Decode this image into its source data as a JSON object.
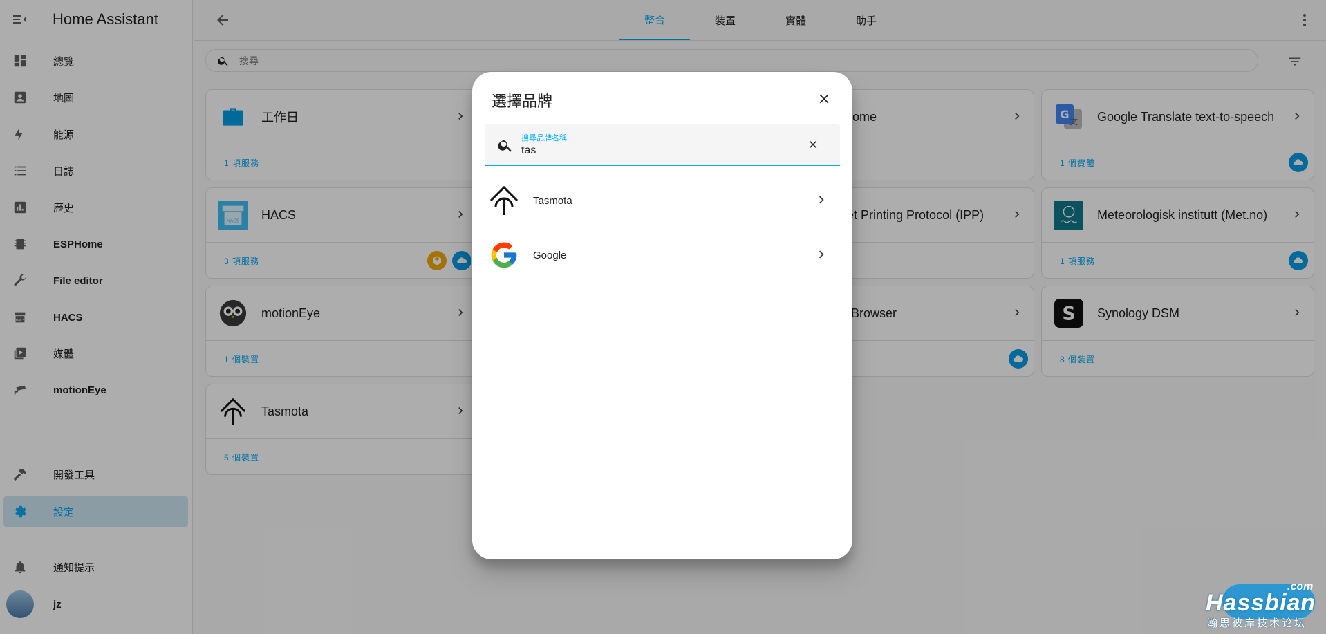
{
  "app": {
    "title": "Home Assistant"
  },
  "sidebar": {
    "items": [
      {
        "label": "總覽",
        "icon": "dashboard-icon"
      },
      {
        "label": "地圖",
        "icon": "map-icon"
      },
      {
        "label": "能源",
        "icon": "lightning-icon"
      },
      {
        "label": "日誌",
        "icon": "list-icon"
      },
      {
        "label": "歷史",
        "icon": "chart-icon"
      },
      {
        "label": "ESPHome",
        "icon": "chip-icon"
      },
      {
        "label": "File editor",
        "icon": "wrench-icon"
      },
      {
        "label": "HACS",
        "icon": "hacs-icon"
      },
      {
        "label": "媒體",
        "icon": "media-icon"
      },
      {
        "label": "motionEye",
        "icon": "cctv-icon"
      }
    ],
    "dev_tools": "開發工具",
    "settings": "設定",
    "notifications": "通知提示",
    "user": "jz"
  },
  "tabs": [
    {
      "label": "整合",
      "active": true
    },
    {
      "label": "裝置",
      "active": false
    },
    {
      "label": "實體",
      "active": false
    },
    {
      "label": "助手",
      "active": false
    }
  ],
  "search": {
    "placeholder": "搜尋"
  },
  "cards": [
    {
      "name": "工作日",
      "link": "1 項服務"
    },
    {
      "name": "ome",
      "link": ""
    },
    {
      "name": "Google Translate text-to-speech",
      "link": "1 個實體"
    },
    {
      "name": "HACS",
      "link": "3 項服務"
    },
    {
      "name": "et Printing Protocol (IPP)",
      "link": ""
    },
    {
      "name": "Meteorologisk institutt (Met.no)",
      "link": "1 項服務"
    },
    {
      "name": "motionEye",
      "link": "1 個裝置"
    },
    {
      "name": "Browser",
      "link": ""
    },
    {
      "name": "Synology DSM",
      "link": "8 個裝置"
    },
    {
      "name": "Tasmota",
      "link": "5 個裝置"
    }
  ],
  "dialog": {
    "title": "選擇品牌",
    "field_label": "搜尋品牌名稱",
    "field_value": "tas",
    "results": [
      {
        "name": "Tasmota"
      },
      {
        "name": "Google"
      }
    ]
  },
  "watermark": {
    "com": ".com",
    "main": "Hassbian",
    "sub": "瀚思彼岸技术论坛"
  },
  "colors": {
    "accent": "#03a9f4",
    "cloud": "#039be5",
    "active_bg": "#cfe6f3"
  }
}
